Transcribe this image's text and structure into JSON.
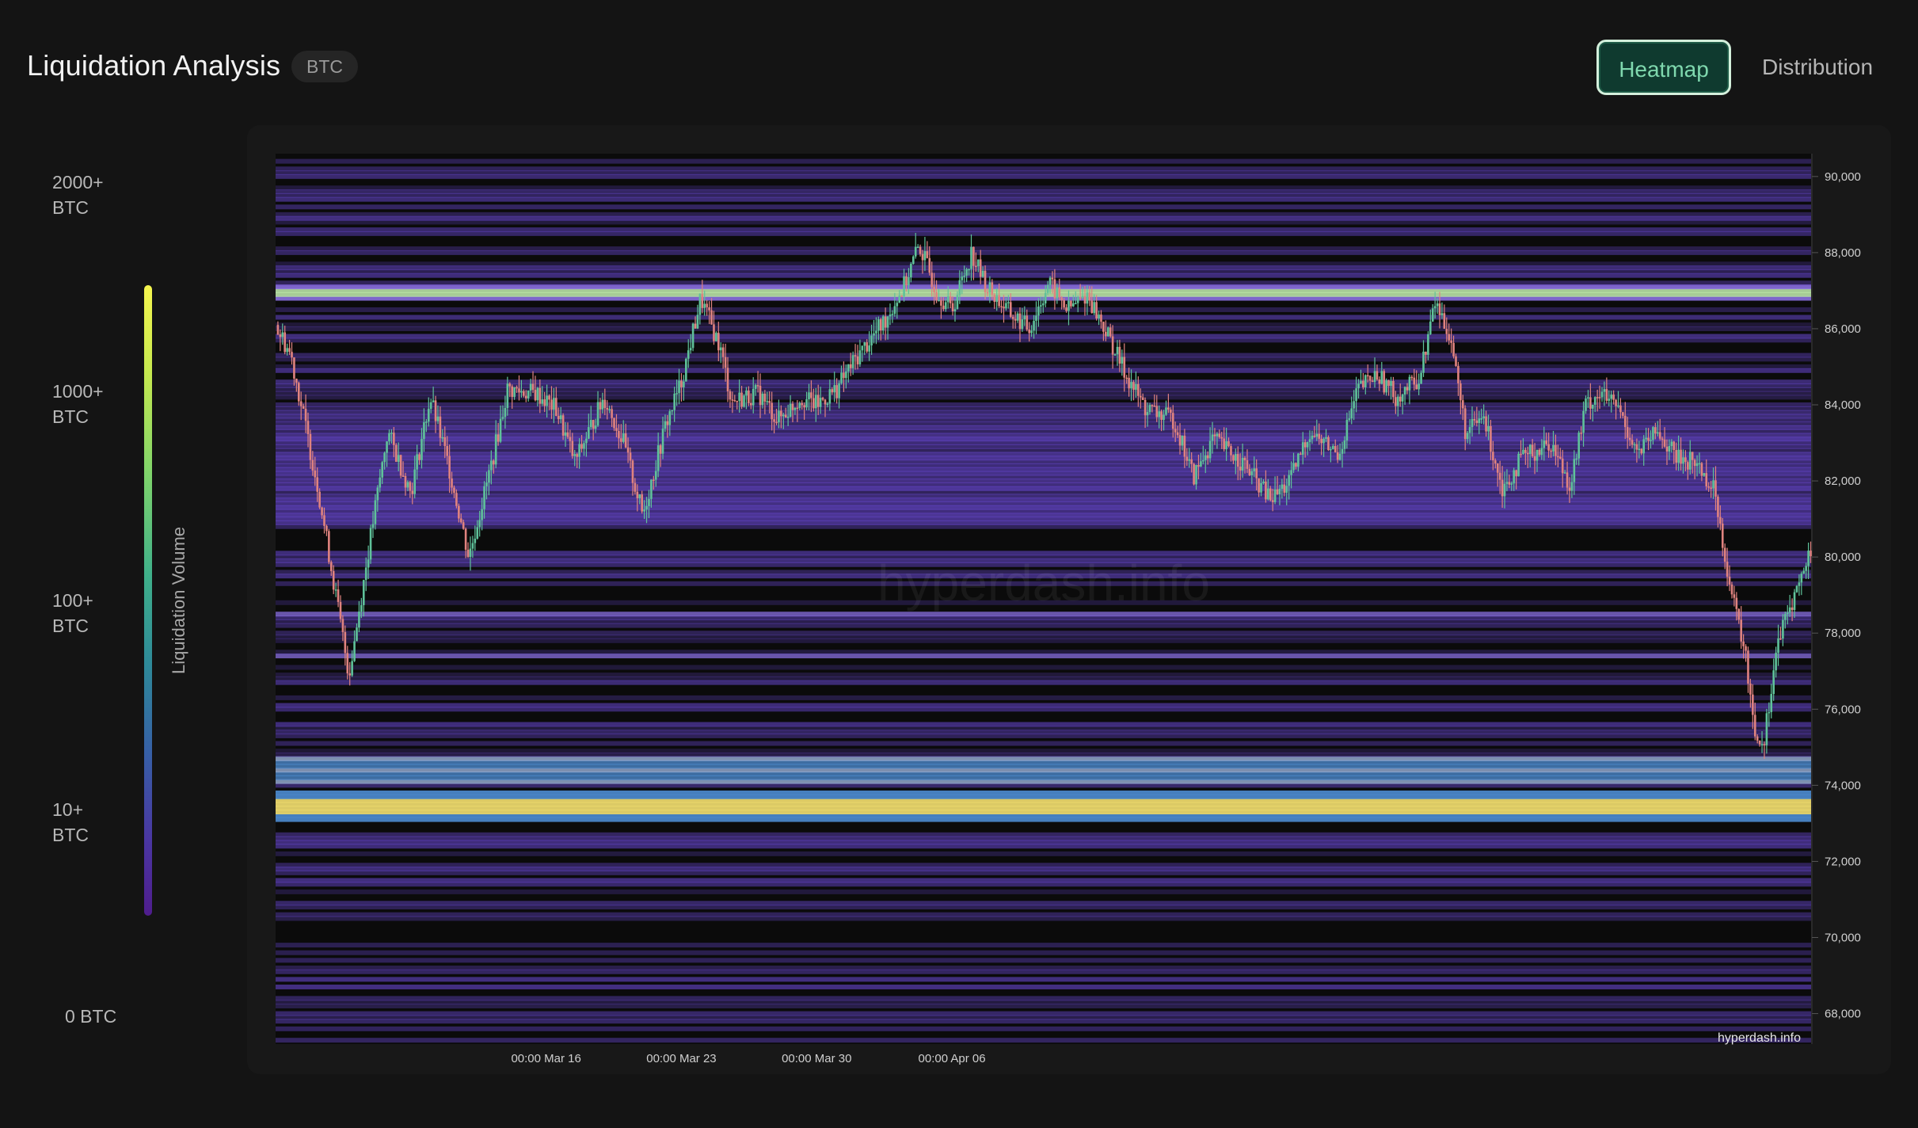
{
  "header": {
    "title": "Liquidation Analysis",
    "asset": "BTC",
    "tabs": [
      {
        "label": "Heatmap",
        "active": true
      },
      {
        "label": "Distribution",
        "active": false
      }
    ]
  },
  "legend": {
    "title": "Liquidation Volume",
    "levels": [
      {
        "line1": "2000+",
        "line2": "BTC"
      },
      {
        "line1": "1000+",
        "line2": "BTC"
      },
      {
        "line1": "100+",
        "line2": "BTC"
      },
      {
        "line1": "10+",
        "line2": "BTC"
      }
    ],
    "zero_label": "0 BTC",
    "gradient_colors": [
      "#f5f54e",
      "#c6e94f",
      "#7fd46b",
      "#3fb08a",
      "#2e8a99",
      "#3660a6",
      "#4a36a2",
      "#4f1d8d"
    ]
  },
  "chart_data": {
    "type": "heatmap",
    "y_ticks": [
      "90,000",
      "88,000",
      "86,000",
      "84,000",
      "82,000",
      "80,000",
      "78,000",
      "76,000",
      "74,000",
      "72,000",
      "70,000",
      "68,000"
    ],
    "x_ticks": [
      "00:00 Mar 16",
      "00:00 Mar 23",
      "00:00 Mar 30",
      "00:00 Apr 06"
    ],
    "ylim": [
      67200,
      90600
    ],
    "watermark": "hyperdash.info",
    "credit": "hyperdash.info",
    "colors": {
      "up": "#5fc29a",
      "down": "#e0837f",
      "low": "#5b3fb5",
      "mid": "#8a6fe0",
      "high": "#e8d56a",
      "blue": "#4a86c8"
    },
    "price_path": [
      [
        0,
        86100
      ],
      [
        0.8,
        85300
      ],
      [
        2.2,
        81800
      ],
      [
        3.8,
        76900
      ],
      [
        5.0,
        80800
      ],
      [
        5.8,
        83300
      ],
      [
        7.0,
        81700
      ],
      [
        8.0,
        84200
      ],
      [
        9.0,
        82300
      ],
      [
        10.0,
        80000
      ],
      [
        11.2,
        82500
      ],
      [
        12.0,
        84400
      ],
      [
        13.5,
        84300
      ],
      [
        14.5,
        83900
      ],
      [
        15.5,
        82500
      ],
      [
        17.0,
        84200
      ],
      [
        18.0,
        83000
      ],
      [
        19.0,
        81100
      ],
      [
        20.2,
        83500
      ],
      [
        21.0,
        84600
      ],
      [
        22.0,
        86800
      ],
      [
        23.0,
        85500
      ],
      [
        23.6,
        84100
      ],
      [
        25.0,
        84300
      ],
      [
        26.0,
        83600
      ],
      [
        27.2,
        84200
      ],
      [
        28.0,
        84000
      ],
      [
        29.0,
        84400
      ],
      [
        30.0,
        85200
      ],
      [
        31.5,
        86200
      ],
      [
        32.5,
        87100
      ],
      [
        33.3,
        88200
      ],
      [
        34.2,
        87000
      ],
      [
        35.0,
        86500
      ],
      [
        36.0,
        88000
      ],
      [
        36.8,
        87100
      ],
      [
        38.0,
        86400
      ],
      [
        39.0,
        86000
      ],
      [
        40.0,
        87200
      ],
      [
        41.0,
        86500
      ],
      [
        42.0,
        86900
      ],
      [
        43.0,
        85900
      ],
      [
        44.0,
        84800
      ],
      [
        45.0,
        83900
      ],
      [
        46.5,
        83600
      ],
      [
        47.5,
        82100
      ],
      [
        48.5,
        83100
      ],
      [
        50.0,
        82500
      ],
      [
        51.5,
        81500
      ],
      [
        52.5,
        82000
      ],
      [
        53.5,
        83300
      ],
      [
        55.0,
        82700
      ],
      [
        56.0,
        84400
      ],
      [
        57.0,
        84800
      ],
      [
        58.0,
        84200
      ],
      [
        59.2,
        84700
      ],
      [
        60.0,
        86700
      ],
      [
        60.8,
        85800
      ],
      [
        61.6,
        83200
      ],
      [
        62.5,
        83700
      ],
      [
        63.5,
        81800
      ],
      [
        64.5,
        82600
      ],
      [
        66.0,
        83000
      ],
      [
        67.0,
        81900
      ],
      [
        67.8,
        84000
      ],
      [
        68.5,
        84300
      ],
      [
        69.5,
        83900
      ],
      [
        70.5,
        82700
      ],
      [
        71.5,
        83300
      ],
      [
        72.5,
        82600
      ],
      [
        73.5,
        82500
      ],
      [
        74.5,
        81700
      ],
      [
        75.3,
        79100
      ],
      [
        76.0,
        77600
      ],
      [
        76.6,
        75300
      ],
      [
        77.0,
        75100
      ],
      [
        77.7,
        77700
      ],
      [
        78.6,
        79000
      ],
      [
        79.5,
        80200
      ]
    ]
  }
}
